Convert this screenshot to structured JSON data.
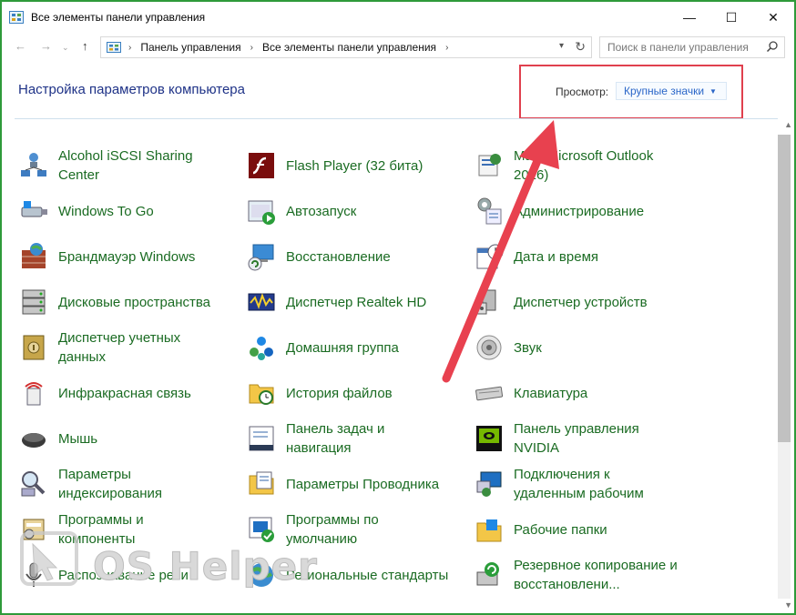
{
  "window": {
    "title": "Все элементы панели управления",
    "minimize": "—",
    "maximize": "☐",
    "close": "✕"
  },
  "address": {
    "crumbs": [
      "Панель управления",
      "Все элементы панели управления"
    ],
    "search_placeholder": "Поиск в панели управления"
  },
  "header": {
    "title": "Настройка параметров компьютера",
    "view_label": "Просмотр:",
    "view_value": "Крупные значки"
  },
  "items": [
    {
      "label": "Alcohol iSCSI Sharing Center",
      "icon": "network-share-icon"
    },
    {
      "label": "Flash Player (32 бита)",
      "icon": "flash-player-icon"
    },
    {
      "label": "Mail (Microsoft Outlook 2016)",
      "icon": "mail-icon"
    },
    {
      "label": "Windows To Go",
      "icon": "usb-drive-icon"
    },
    {
      "label": "Автозапуск",
      "icon": "autoplay-icon"
    },
    {
      "label": "Администрирование",
      "icon": "admin-tools-icon"
    },
    {
      "label": "Брандмауэр Windows",
      "icon": "firewall-icon"
    },
    {
      "label": "Восстановление",
      "icon": "recovery-icon"
    },
    {
      "label": "Дата и время",
      "icon": "calendar-clock-icon"
    },
    {
      "label": "Дисковые пространства",
      "icon": "storage-spaces-icon"
    },
    {
      "label": "Диспетчер Realtek HD",
      "icon": "realtek-audio-icon"
    },
    {
      "label": "Диспетчер устройств",
      "icon": "device-manager-icon"
    },
    {
      "label": "Диспетчер учетных данных",
      "icon": "credential-vault-icon"
    },
    {
      "label": "Домашняя группа",
      "icon": "homegroup-icon"
    },
    {
      "label": "Звук",
      "icon": "speaker-icon"
    },
    {
      "label": "Инфракрасная связь",
      "icon": "infrared-icon"
    },
    {
      "label": "История файлов",
      "icon": "file-history-icon"
    },
    {
      "label": "Клавиатура",
      "icon": "keyboard-icon"
    },
    {
      "label": "Мышь",
      "icon": "mouse-icon"
    },
    {
      "label": "Панель задач и навигация",
      "icon": "taskbar-icon"
    },
    {
      "label": "Панель управления NVIDIA",
      "icon": "nvidia-icon"
    },
    {
      "label": "Параметры индексирования",
      "icon": "indexing-icon"
    },
    {
      "label": "Параметры Проводника",
      "icon": "folder-options-icon"
    },
    {
      "label": "Подключения к удаленным рабочим",
      "icon": "remote-desktop-icon"
    },
    {
      "label": "Программы и компоненты",
      "icon": "programs-icon"
    },
    {
      "label": "Программы по умолчанию",
      "icon": "default-programs-icon"
    },
    {
      "label": "Рабочие папки",
      "icon": "work-folders-icon"
    },
    {
      "label": "Распознавание речи",
      "icon": "microphone-icon"
    },
    {
      "label": "Региональные стандарты",
      "icon": "region-icon"
    },
    {
      "label": "Резервное копирование и восстановлени...",
      "icon": "backup-icon"
    }
  ],
  "watermark": {
    "text": "OS Helper"
  },
  "colors": {
    "link_green": "#1a6b22",
    "title_blue": "#1e3287",
    "frame_green": "#2e9a3a",
    "highlight_red": "#e0404e"
  }
}
